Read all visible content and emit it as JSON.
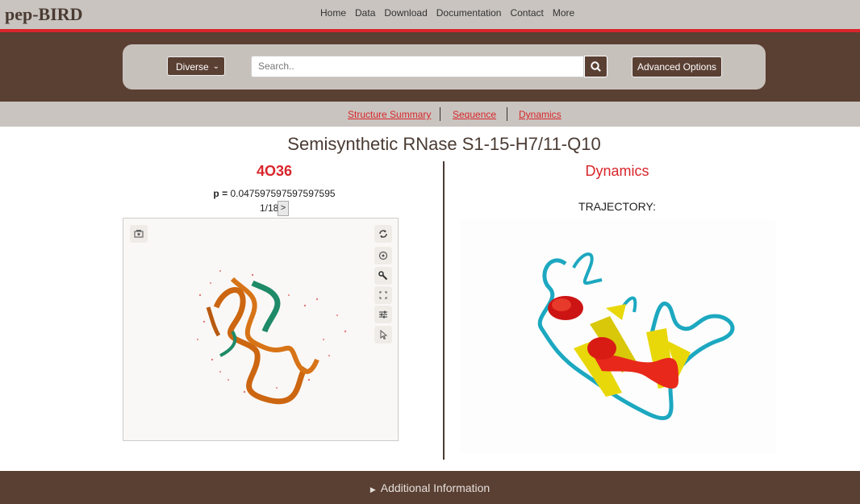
{
  "app": {
    "logo": "pep-BIRD"
  },
  "nav": {
    "items": [
      "Home",
      "Data",
      "Download",
      "Documentation",
      "Contact",
      "More"
    ]
  },
  "search": {
    "select_value": "Diverse",
    "placeholder": "Search..",
    "advanced_label": "Advanced Options"
  },
  "tabs": [
    "Structure Summary",
    "Sequence",
    "Dynamics"
  ],
  "main": {
    "title": "Semisynthetic RNase S1-15-H7/11-Q10",
    "pdb_id": "4O36",
    "p_label": "p =",
    "p_value": "0.047597597597597595",
    "pager": "1/18",
    "pager_next": ">"
  },
  "dynamics": {
    "title": "Dynamics",
    "trajectory_label": "TRAJECTORY:"
  },
  "footer": {
    "label": "Additional Information"
  },
  "colors": {
    "brown": "#5a3f33",
    "red": "#d9262b",
    "grey": "#c9c4bf"
  },
  "icons": [
    "search-icon",
    "camera-icon",
    "rotate-icon",
    "center-icon",
    "wrench-icon",
    "fullscreen-icon",
    "settings-icon",
    "pointer-icon",
    "triangle-right-icon"
  ]
}
